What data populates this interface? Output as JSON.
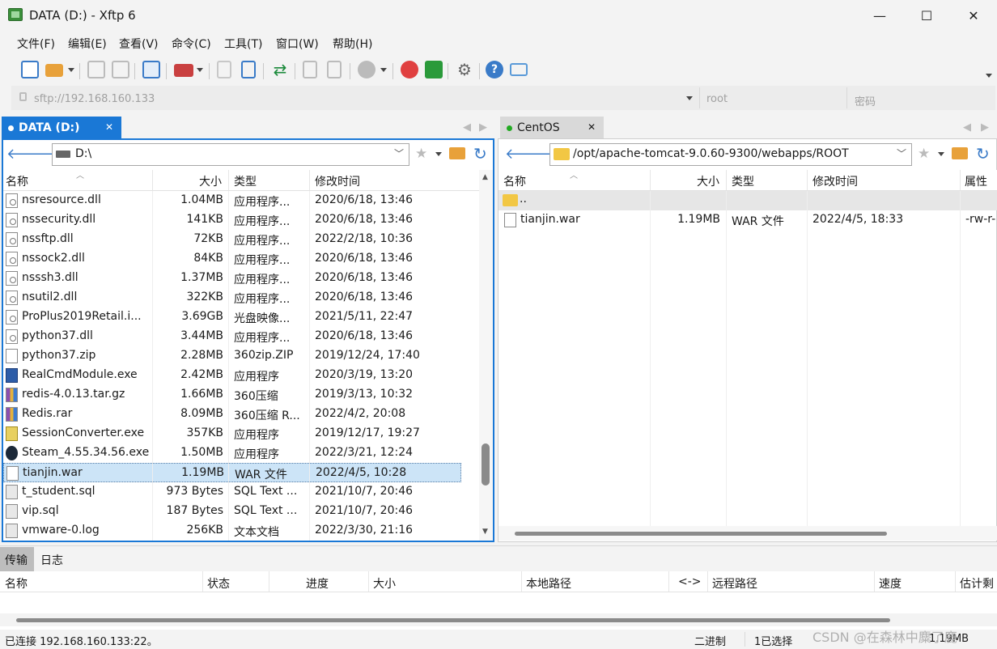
{
  "window": {
    "title": "DATA (D:) - Xftp 6",
    "minimize": "—",
    "maximize": "☐",
    "close": "✕"
  },
  "menu": [
    "文件(F)",
    "编辑(E)",
    "查看(V)",
    "命令(C)",
    "工具(T)",
    "窗口(W)",
    "帮助(H)"
  ],
  "address": {
    "host_placeholder": "sftp://192.168.160.133",
    "user_placeholder": "root",
    "password_placeholder": "密码"
  },
  "local": {
    "tab_label": "DATA (D:)",
    "path": "D:\\",
    "columns": [
      "名称",
      "大小",
      "类型",
      "修改时间"
    ],
    "files": [
      {
        "name": "nsresource.dll",
        "size": "1.04MB",
        "type": "应用程序...",
        "modified": "2020/6/18, 13:46",
        "icon": "dll-icon"
      },
      {
        "name": "nssecurity.dll",
        "size": "141KB",
        "type": "应用程序...",
        "modified": "2020/6/18, 13:46",
        "icon": "dll-icon"
      },
      {
        "name": "nssftp.dll",
        "size": "72KB",
        "type": "应用程序...",
        "modified": "2022/2/18, 10:36",
        "icon": "dll-icon"
      },
      {
        "name": "nssock2.dll",
        "size": "84KB",
        "type": "应用程序...",
        "modified": "2020/6/18, 13:46",
        "icon": "dll-icon"
      },
      {
        "name": "nsssh3.dll",
        "size": "1.37MB",
        "type": "应用程序...",
        "modified": "2020/6/18, 13:46",
        "icon": "dll-icon"
      },
      {
        "name": "nsutil2.dll",
        "size": "322KB",
        "type": "应用程序...",
        "modified": "2020/6/18, 13:46",
        "icon": "dll-icon"
      },
      {
        "name": "ProPlus2019Retail.i...",
        "size": "3.69GB",
        "type": "光盘映像...",
        "modified": "2021/5/11, 22:47",
        "icon": "iso-icon"
      },
      {
        "name": "python37.dll",
        "size": "3.44MB",
        "type": "应用程序...",
        "modified": "2020/6/18, 13:46",
        "icon": "dll-icon"
      },
      {
        "name": "python37.zip",
        "size": "2.28MB",
        "type": "360zip.ZIP",
        "modified": "2019/12/24, 17:40",
        "icon": "file-icon"
      },
      {
        "name": "RealCmdModule.exe",
        "size": "2.42MB",
        "type": "应用程序",
        "modified": "2020/3/19, 13:20",
        "icon": "exe-icon"
      },
      {
        "name": "redis-4.0.13.tar.gz",
        "size": "1.66MB",
        "type": "360压缩",
        "modified": "2019/3/13, 10:32",
        "icon": "archive-icon"
      },
      {
        "name": "Redis.rar",
        "size": "8.09MB",
        "type": "360压缩 R...",
        "modified": "2022/4/2, 20:08",
        "icon": "archive-icon"
      },
      {
        "name": "SessionConverter.exe",
        "size": "357KB",
        "type": "应用程序",
        "modified": "2019/12/17, 19:27",
        "icon": "converter-icon"
      },
      {
        "name": "Steam_4.55.34.56.exe",
        "size": "1.50MB",
        "type": "应用程序",
        "modified": "2022/3/21, 12:24",
        "icon": "steam-icon"
      },
      {
        "name": "tianjin.war",
        "size": "1.19MB",
        "type": "WAR 文件",
        "modified": "2022/4/5, 10:28",
        "icon": "file-icon",
        "selected": true
      },
      {
        "name": "t_student.sql",
        "size": "973 Bytes",
        "type": "SQL Text ...",
        "modified": "2021/10/7, 20:46",
        "icon": "sql-icon"
      },
      {
        "name": "vip.sql",
        "size": "187 Bytes",
        "type": "SQL Text ...",
        "modified": "2021/10/7, 20:46",
        "icon": "sql-icon"
      },
      {
        "name": "vmware-0.log",
        "size": "256KB",
        "type": "文本文档",
        "modified": "2022/3/30, 21:16",
        "icon": "text-file-icon"
      }
    ]
  },
  "remote": {
    "tab_label": "CentOS",
    "path": "/opt/apache-tomcat-9.0.60-9300/webapps/ROOT",
    "columns": [
      "名称",
      "大小",
      "类型",
      "修改时间",
      "属性"
    ],
    "parent": "..",
    "files": [
      {
        "name": "tianjin.war",
        "size": "1.19MB",
        "type": "WAR 文件",
        "modified": "2022/4/5, 18:33",
        "attrs": "-rw-r-"
      }
    ]
  },
  "transfer": {
    "tabs": [
      "传输",
      "日志"
    ],
    "columns": [
      "名称",
      "状态",
      "进度",
      "大小",
      "本地路径",
      "<->",
      "远程路径",
      "速度",
      "估计剩"
    ]
  },
  "status": {
    "connection": "已连接 192.168.160.133:22。",
    "mode": "二进制",
    "selection": "1已选择",
    "size": "1.19MB",
    "watermark": "CSDN @在森林中麋了鹿"
  },
  "colors": {
    "accent": "#1a78d6",
    "selection": "#cce4f7",
    "remote_dot": "#22aa22"
  }
}
